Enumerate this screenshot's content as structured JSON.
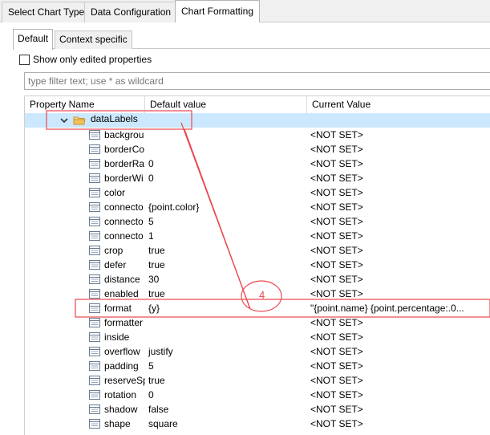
{
  "tabs": [
    "Select Chart Type",
    "Data Configuration",
    "Chart Formatting"
  ],
  "subtabs": [
    "Default",
    "Context specific"
  ],
  "checkbox_label": "Show only edited properties",
  "filter_placeholder": "type filter text; use * as wildcard",
  "columns": [
    "Property Name",
    "Default value",
    "Current Value"
  ],
  "group": "dataLabels",
  "properties": [
    {
      "name": "backgrou",
      "default": "",
      "current": "<NOT SET>"
    },
    {
      "name": "borderCo",
      "default": "",
      "current": "<NOT SET>"
    },
    {
      "name": "borderRa",
      "default": "0",
      "current": "<NOT SET>"
    },
    {
      "name": "borderWi",
      "default": "0",
      "current": "<NOT SET>"
    },
    {
      "name": "color",
      "default": "",
      "current": "<NOT SET>"
    },
    {
      "name": "connecto",
      "default": "{point.color}",
      "current": "<NOT SET>"
    },
    {
      "name": "connecto",
      "default": "5",
      "current": "<NOT SET>"
    },
    {
      "name": "connecto",
      "default": "1",
      "current": "<NOT SET>"
    },
    {
      "name": "crop",
      "default": "true",
      "current": "<NOT SET>"
    },
    {
      "name": "defer",
      "default": "true",
      "current": "<NOT SET>"
    },
    {
      "name": "distance",
      "default": "30",
      "current": "<NOT SET>"
    },
    {
      "name": "enabled",
      "default": "true",
      "current": "<NOT SET>"
    },
    {
      "name": "format",
      "default": "{y}",
      "current": "\"{point.name} {point.percentage:.0..."
    },
    {
      "name": "formatter",
      "default": "",
      "current": "<NOT SET>"
    },
    {
      "name": "inside",
      "default": "",
      "current": "<NOT SET>"
    },
    {
      "name": "overflow",
      "default": "justify",
      "current": "<NOT SET>"
    },
    {
      "name": "padding",
      "default": "5",
      "current": "<NOT SET>"
    },
    {
      "name": "reserveSp",
      "default": "true",
      "current": "<NOT SET>"
    },
    {
      "name": "rotation",
      "default": "0",
      "current": "<NOT SET>"
    },
    {
      "name": "shadow",
      "default": "false",
      "current": "<NOT SET>"
    },
    {
      "name": "shape",
      "default": "square",
      "current": "<NOT SET>"
    }
  ],
  "annotation_number": "4",
  "colors": {
    "selection": "#cce8ff",
    "annotation": "#e8474e",
    "folder": "#e8b14a"
  }
}
